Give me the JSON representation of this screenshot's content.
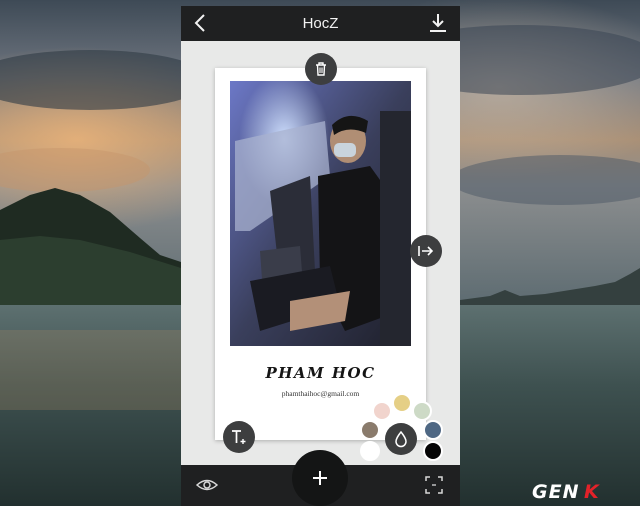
{
  "app": {
    "title": "HocZ"
  },
  "card": {
    "name": "PHAM HOC",
    "email": "phamthaihoc@gmail.com"
  },
  "palette": {
    "swatches": [
      {
        "name": "pink",
        "color": "#f1d4cd"
      },
      {
        "name": "gold",
        "color": "#e5cf86"
      },
      {
        "name": "sage",
        "color": "#cddac6"
      },
      {
        "name": "brown",
        "color": "#8a7b6c"
      },
      {
        "name": "slate-blue",
        "color": "#4f6884"
      },
      {
        "name": "white",
        "color": "#ffffff"
      },
      {
        "name": "black",
        "color": "#050505"
      }
    ]
  },
  "icons": {
    "back": "chevron-left-icon",
    "download": "download-icon",
    "delete": "trash-icon",
    "resize": "resize-arrow-icon",
    "add_text": "text-plus-icon",
    "color": "droplet-icon",
    "add": "plus-icon",
    "preview": "eye-icon",
    "crop": "crop-frame-icon"
  },
  "watermark": {
    "text": "GENK"
  }
}
